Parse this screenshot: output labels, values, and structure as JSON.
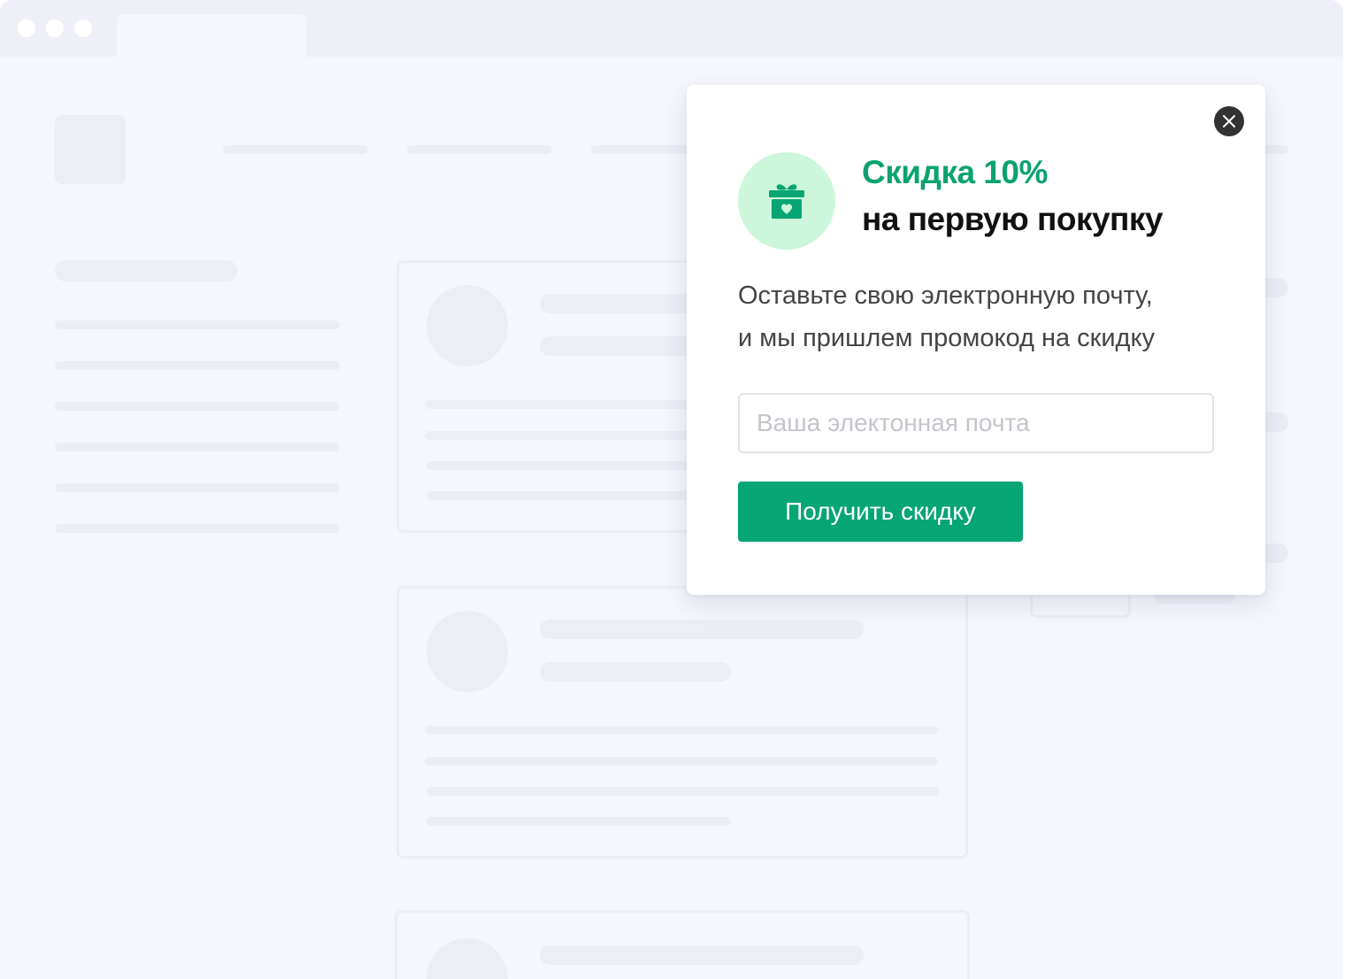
{
  "popup": {
    "title_accent": "Скидка 10%",
    "title_main": "на первую покупку",
    "description_line1": "Оставьте свою электронную почту,",
    "description_line2": "и мы пришлем промокод на скидку",
    "email_placeholder": "Ваша электонная почта",
    "email_value": "",
    "submit_label": "Получить скидку",
    "close_icon": "close-icon",
    "gift_icon": "gift-icon"
  },
  "colors": {
    "accent": "#0aa36e",
    "button": "#06a574",
    "icon_bg": "#cdf7dc",
    "background": "#f6f7fc"
  }
}
